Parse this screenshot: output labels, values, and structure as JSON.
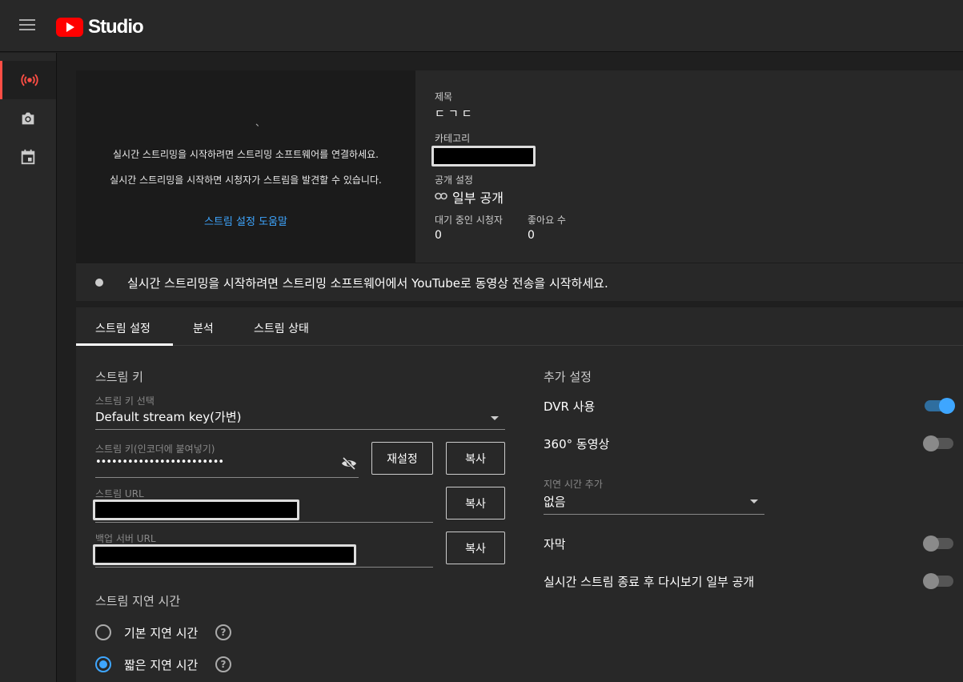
{
  "app": {
    "logo_text": "Studio"
  },
  "sidebar": {
    "items": [
      {
        "name": "live",
        "icon": "broadcast-icon",
        "active": true
      },
      {
        "name": "webcam",
        "icon": "camera-icon"
      },
      {
        "name": "managed",
        "icon": "calendar-icon"
      }
    ]
  },
  "preview": {
    "dot": "、",
    "message1": "실시간 스트리밍을 시작하려면 스트리밍 소프트웨어를 연결하세요.",
    "message2": "실시간 스트리밍을 시작하면 시청자가 스트림을 발견할 수 있습니다.",
    "help_link": "스트림 설정 도움말"
  },
  "info": {
    "title_label": "제목",
    "title_value": "ㄷㄱㄷ",
    "category_label": "카테고리",
    "visibility_label": "공개 설정",
    "visibility_value": "일부 공개",
    "waiting_label": "대기 중인 시청자",
    "waiting_value": "0",
    "likes_label": "좋아요 수",
    "likes_value": "0"
  },
  "banner": {
    "text": "실시간 스트리밍을 시작하려면 스트리밍 소프트웨어에서 YouTube로 동영상 전송을 시작하세요."
  },
  "tabs": [
    "스트림 설정",
    "분석",
    "스트림 상태"
  ],
  "stream_key": {
    "section_title": "스트림 키",
    "select_label": "스트림 키 선택",
    "select_value": "Default stream key(가변)",
    "key_label": "스트림 키(인코더에 붙여넣기)",
    "key_value": "••••••••••••••••••••••••",
    "reset_button": "재설정",
    "copy_button": "복사",
    "url_label": "스트림 URL",
    "backup_label": "백업 서버 URL"
  },
  "latency": {
    "section_title": "스트림 지연 시간",
    "options": [
      {
        "label": "기본 지연 시간",
        "selected": false
      },
      {
        "label": "짧은 지연 시간",
        "selected": true
      }
    ],
    "help_glyph": "?"
  },
  "additional": {
    "section_title": "추가 설정",
    "dvr_label": "DVR 사용",
    "dvr_on": true,
    "vr360_label": "360° 동영상",
    "vr360_on": false,
    "delay_label": "지연 시간 추가",
    "delay_value": "없음",
    "captions_label": "자막",
    "captions_on": false,
    "replay_label": "실시간 스트림 종료 후 다시보기 일부 공개",
    "replay_on": false
  },
  "colors": {
    "accent": "#3ea6ff",
    "brand": "#ff0000",
    "active_indicator": "#ff4e45"
  }
}
